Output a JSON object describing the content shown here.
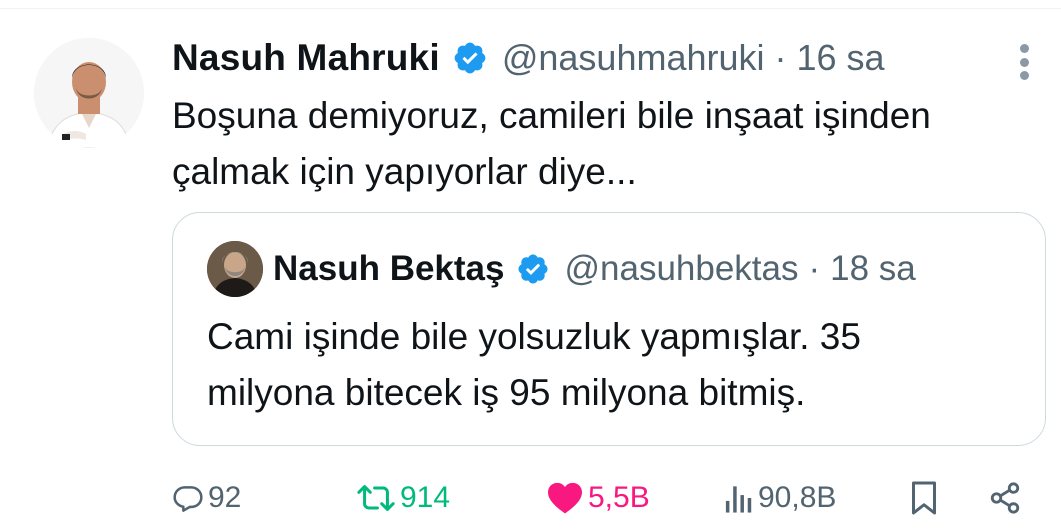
{
  "tweet": {
    "author_name": "Nasuh Mahruki",
    "handle": "@nasuhmahruki",
    "separator": "·",
    "time": "16 sa",
    "text_line1": "Boşuna demiyoruz, camileri bile inşaat işinden",
    "text_line2": "çalmak için yapıyorlar diye..."
  },
  "quoted": {
    "author_name": "Nasuh Bektaş",
    "handle": "@nasuhbektas",
    "separator": "·",
    "time": "18 sa",
    "text_line1": "Cami işinde bile yolsuzluk yapmışlar. 35",
    "text_line2": "milyona bitecek iş 95 milyona bitmiş."
  },
  "actions": {
    "replies": "92",
    "retweets": "914",
    "likes": "5,5B",
    "views": "90,8B"
  },
  "colors": {
    "verified": "#1d9bf0",
    "retweet_active": "#00ba7c",
    "like_active": "#f91880",
    "secondary_text": "#536471"
  },
  "icons": [
    "verified-badge-icon",
    "more-options-icon",
    "reply-icon",
    "retweet-icon",
    "heart-icon",
    "views-icon",
    "bookmark-icon",
    "share-icon"
  ]
}
